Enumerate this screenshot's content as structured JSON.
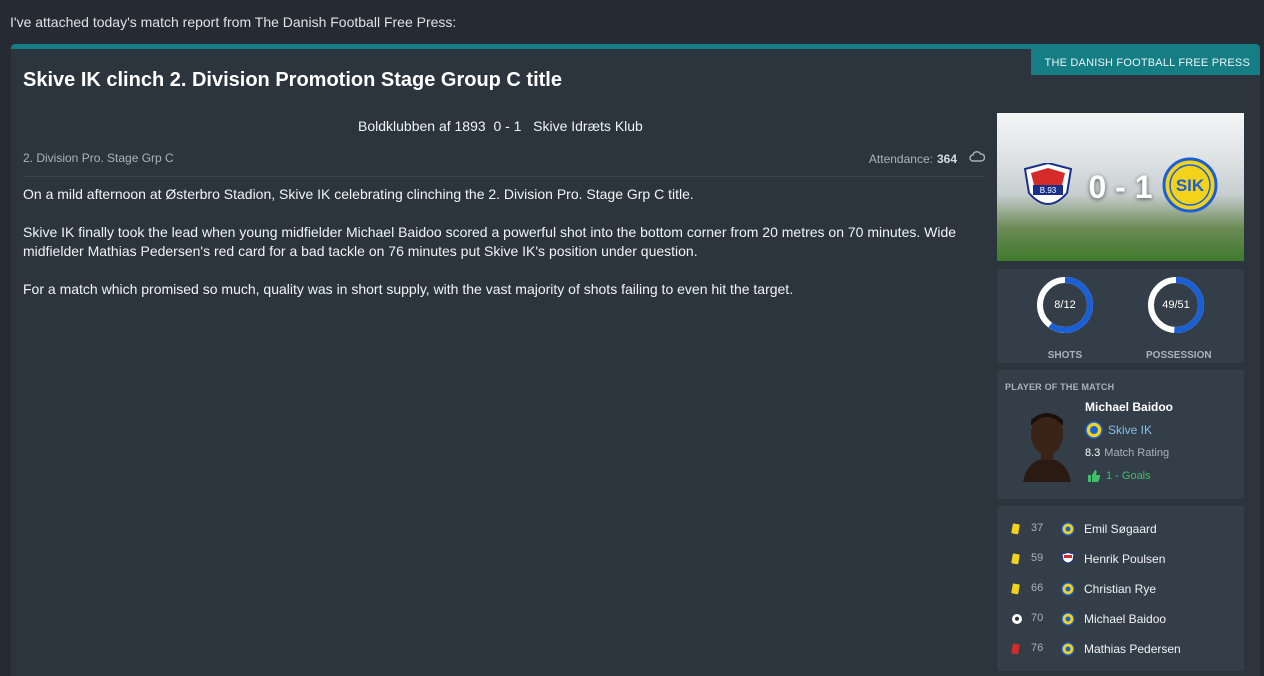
{
  "intro_text": "I've attached today's match report from The Danish Football Free Press:",
  "source_tab": "THE DANISH FOOTBALL FREE PRESS",
  "headline": "Skive IK clinch 2. Division Promotion Stage Group C title",
  "scoreline": "Boldklubben af 1893  0 - 1   Skive Idræts Klub",
  "competition": "2. Division Pro. Stage Grp C",
  "attendance_label": "Attendance:",
  "attendance_value": "364",
  "weather_icon": "cloud-icon",
  "paragraphs": [
    "On a mild afternoon at Østerbro Stadion, Skive IK celebrating clinching the 2. Division Pro. Stage Grp C title.",
    "Skive IK finally took the lead when young midfielder Michael Baidoo scored a powerful shot into the bottom corner from 20 metres on 70 minutes. Wide midfielder Mathias Pedersen's red card for a bad tackle on 76 minutes put Skive IK's position under question.",
    "For a match which promised so much, quality was in short supply, with the vast majority of shots failing to even hit the target."
  ],
  "score_display": "0 - 1",
  "home_crest_text": "B.93",
  "away_crest_text": "SIK",
  "stats": [
    {
      "label": "SHOTS",
      "value": "8/12",
      "home": 8,
      "away": 12
    },
    {
      "label": "POSSESSION",
      "value": "49/51",
      "home": 49,
      "away": 51
    }
  ],
  "potm": {
    "title": "PLAYER OF THE MATCH",
    "name": "Michael Baidoo",
    "team": "Skive IK",
    "rating": "8.3",
    "rating_label": "Match Rating",
    "goals": "1 - Goals"
  },
  "events": [
    {
      "type": "yellow",
      "minute": "37",
      "team": "away",
      "player": "Emil Søgaard"
    },
    {
      "type": "yellow",
      "minute": "59",
      "team": "home",
      "player": "Henrik Poulsen"
    },
    {
      "type": "yellow",
      "minute": "66",
      "team": "away",
      "player": "Christian Rye"
    },
    {
      "type": "goal",
      "minute": "70",
      "team": "away",
      "player": "Michael Baidoo"
    },
    {
      "type": "red",
      "minute": "76",
      "team": "away",
      "player": "Mathias Pedersen"
    }
  ],
  "colors": {
    "accent": "#157d84",
    "home_blue": "#1a5fd6",
    "yellow_card": "#f2d21b",
    "red_card": "#d62b2b",
    "goal_green": "#3fbf6a"
  }
}
